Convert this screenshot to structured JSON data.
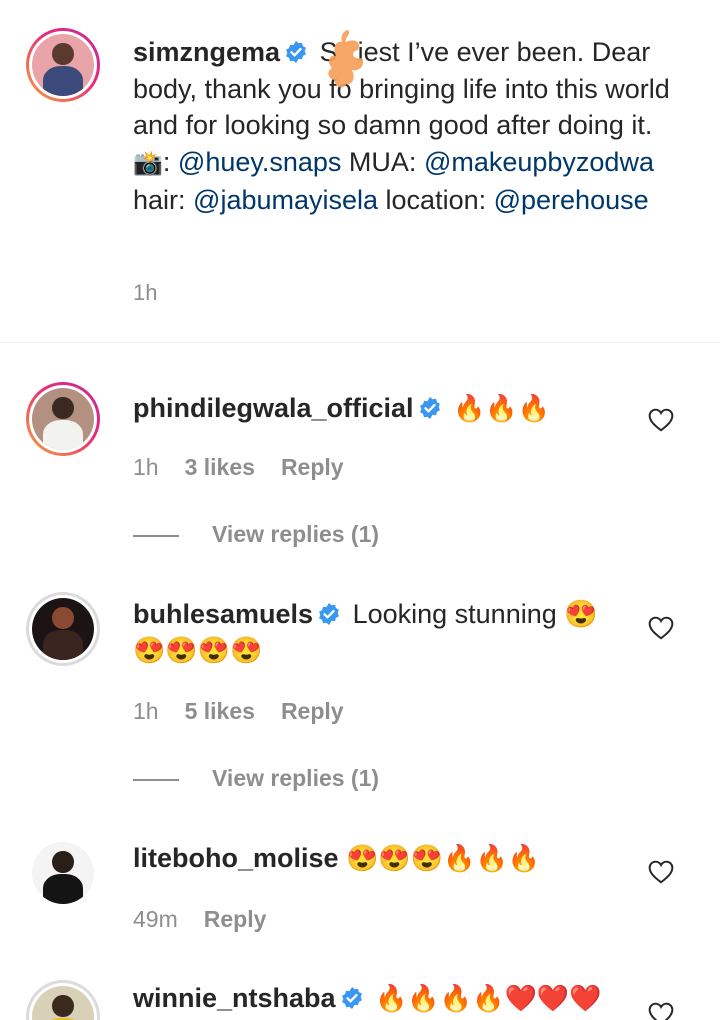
{
  "post": {
    "username": "simzngema",
    "caption_parts": {
      "p1": "S",
      "p2": "iest I’ve ever been. Dear body, thank you fo",
      "p3": " bringing life into this world and for looking so damn good after doing it. ",
      "camera": "📸",
      "p4": ": ",
      "m1": "@huey.snaps",
      "p5": " MUA: ",
      "m2": "@makeupbyzodwa",
      "p6": " hair: ",
      "m3": "@jabumayisela",
      "p7": " location: ",
      "m4": "@perehouse"
    },
    "time": "1h"
  },
  "comments": [
    {
      "username": "phindilegwala_official",
      "text": "🔥🔥🔥",
      "time": "1h",
      "likes": "3 likes",
      "reply": "Reply",
      "view_replies": "View replies (1)"
    },
    {
      "username": "buhlesamuels",
      "text": "Looking stunning 😍",
      "text2": "😍😍😍😍",
      "time": "1h",
      "likes": "5 likes",
      "reply": "Reply",
      "view_replies": "View replies (1)"
    },
    {
      "username": "liteboho_molise",
      "text": "😍😍😍🔥🔥🔥",
      "time": "49m",
      "reply": "Reply"
    },
    {
      "username": "winnie_ntshaba",
      "text": "🔥🔥🔥🔥❤️❤️❤️"
    }
  ],
  "colors": {
    "text": "#262626",
    "secondary": "#8e8e8e",
    "mention": "#00376b",
    "verified": "#3897f0",
    "story_ring_start": "#f9a43d",
    "story_ring_end": "#c0319c"
  },
  "icons": [
    "verified-badge-icon",
    "heart-icon",
    "camera-emoji"
  ]
}
